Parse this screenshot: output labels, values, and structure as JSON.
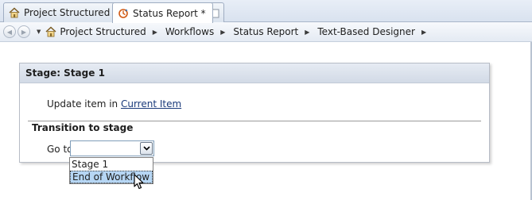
{
  "tabs": [
    {
      "label": "Project Structured",
      "icon": "home-icon",
      "active": false
    },
    {
      "label": "Status Report *",
      "icon": "workflow-icon",
      "active": true
    },
    {
      "label": "",
      "icon": "new-tab-icon",
      "active": false
    }
  ],
  "breadcrumb": {
    "items": [
      "Project Structured",
      "Workflows",
      "Status Report",
      "Text-Based Designer"
    ]
  },
  "stage": {
    "title": "Stage: Stage 1",
    "action_prefix": "Update item in",
    "action_link": "Current Item",
    "transition_title": "Transition to stage",
    "goto_label": "Go to",
    "goto_value": "",
    "options": [
      "Stage 1",
      "End of Workflow"
    ],
    "highlighted_option": "End of Workflow"
  },
  "colors": {
    "accent_highlight": "#b6d6f4",
    "link": "#1a3a7a",
    "header_bg": "#d2dae6"
  }
}
